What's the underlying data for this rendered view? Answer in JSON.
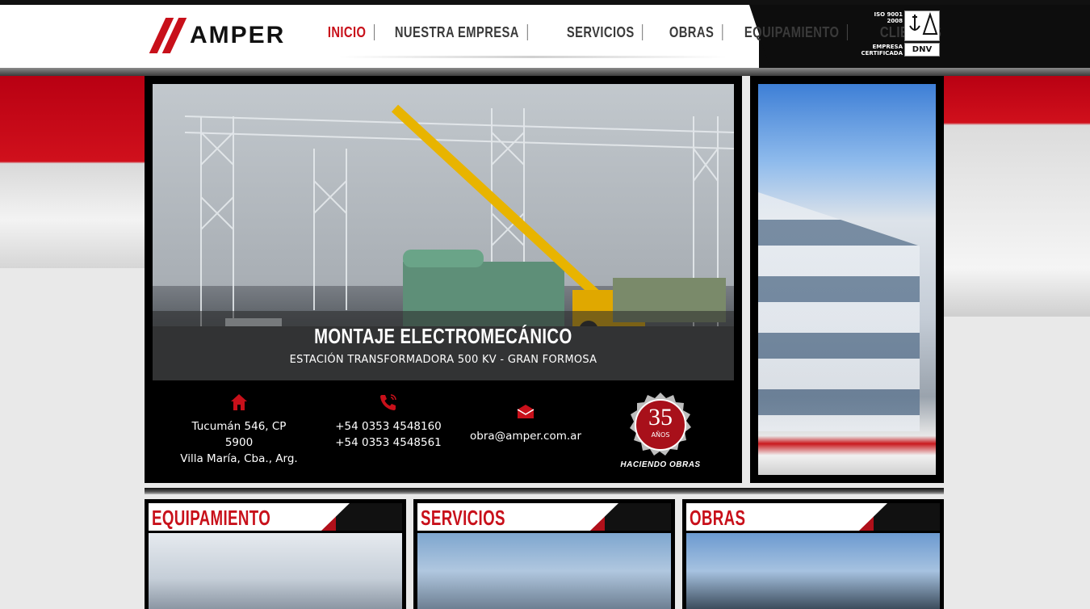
{
  "brand": {
    "name": "AMPER"
  },
  "nav": {
    "items": [
      {
        "label": "INICIO",
        "active": true
      },
      {
        "label": "NUESTRA EMPRESA",
        "active": false
      },
      {
        "label": "SERVICIOS",
        "active": false
      },
      {
        "label": "OBRAS",
        "active": false
      },
      {
        "label": "EQUIPAMIENTO",
        "active": false
      },
      {
        "label": "CLIENTES",
        "active": false
      }
    ]
  },
  "certification": {
    "iso_line1": "ISO 9001",
    "iso_line2": "2008",
    "label_line1": "EMPRESA",
    "label_line2": "CERTIFICADA",
    "certifier": "DNV"
  },
  "slider": {
    "title": "MONTAJE ELECTROMECÁNICO",
    "subtitle": "ESTACIÓN TRANSFORMADORA 500 KV - GRAN FORMOSA"
  },
  "contact": {
    "address_line1": "Tucumán 546, CP 5900",
    "address_line2": "Villa María, Cba., Arg.",
    "phone1": "+54 0353 4548160",
    "phone2": "+54 0353 4548561",
    "email": "obra@amper.com.ar"
  },
  "badge": {
    "years": "35",
    "years_label": "AÑOS",
    "tagline": "HACIENDO OBRAS"
  },
  "sections": [
    {
      "title": "EQUIPAMIENTO"
    },
    {
      "title": "SERVICIOS"
    },
    {
      "title": "OBRAS"
    }
  ],
  "colors": {
    "accent": "#c8101a",
    "dark": "#000000",
    "background": "#e9e9e9"
  },
  "icons": {
    "address": "home-icon",
    "phone": "phone-icon",
    "email": "envelope-icon"
  }
}
